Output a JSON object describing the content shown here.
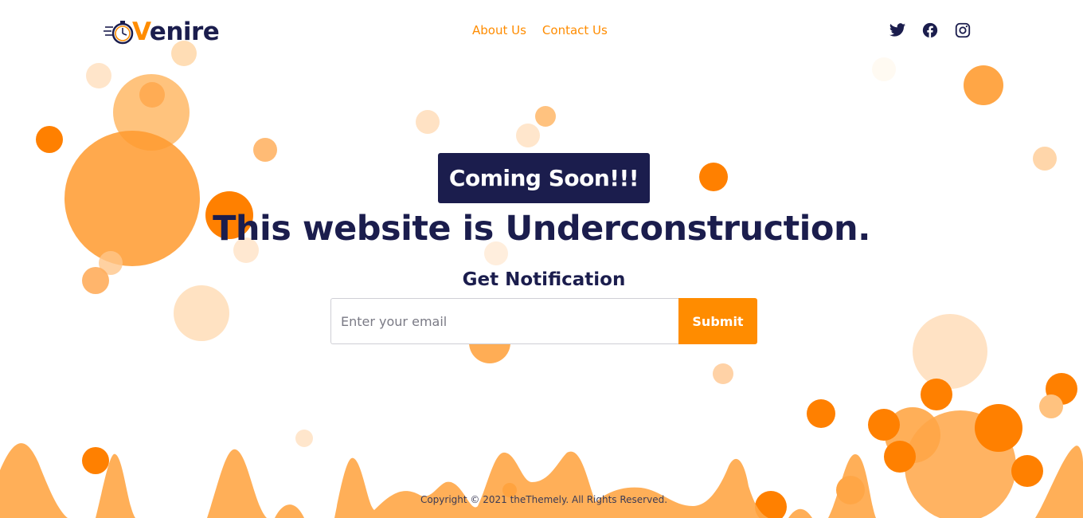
{
  "brand": {
    "logo_text_v": "V",
    "logo_text_rest": "enire",
    "mark_icon": "stopwatch-icon"
  },
  "nav": {
    "items": [
      {
        "label": "About Us"
      },
      {
        "label": "Contact Us"
      }
    ]
  },
  "social": {
    "icons": [
      "twitter-icon",
      "facebook-icon",
      "instagram-icon"
    ]
  },
  "hero": {
    "badge": "Coming Soon!!!",
    "headline": "This website is Underconstruction.",
    "subheading": "Get Notification"
  },
  "form": {
    "email_placeholder": "Enter your email",
    "submit_label": "Submit"
  },
  "footer": {
    "copyright": "Copyright © 2021 theThemely. All Rights Reserved."
  },
  "colors": {
    "accent": "#ff8c00",
    "navy": "#1b1d4d",
    "bubble_light": "#ffdcb4",
    "bubble_mid": "#ffa64a"
  }
}
